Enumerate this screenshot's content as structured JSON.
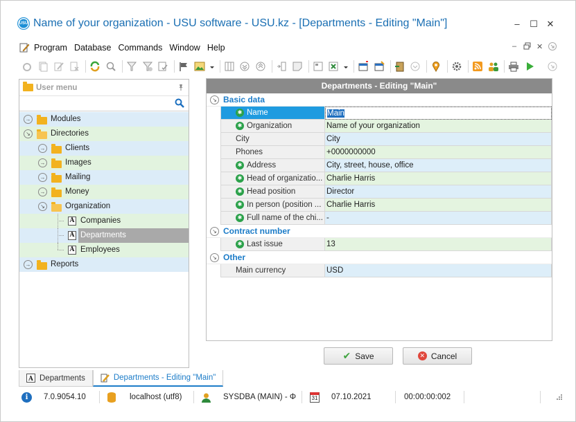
{
  "window": {
    "logo_text": "USU",
    "title": "Name of your organization - USU software - USU.kz - [Departments - Editing \"Main\"]",
    "controls": [
      "–",
      "☐",
      "✕"
    ]
  },
  "menubar": {
    "items": [
      "Program",
      "Database",
      "Commands",
      "Window",
      "Help"
    ],
    "mdi_controls": [
      "–",
      "🗗",
      "✕"
    ]
  },
  "left_panel": {
    "title": "User menu",
    "search_placeholder": "",
    "tree": [
      {
        "label": "Modules",
        "level": 0,
        "expander": "collapsed",
        "icon": "folder-icon",
        "bg": "blue"
      },
      {
        "label": "Directories",
        "level": 0,
        "expander": "expanded",
        "icon": "folder-open-icon",
        "bg": "green"
      },
      {
        "label": "Clients",
        "level": 1,
        "expander": "collapsed",
        "icon": "folder-icon",
        "bg": "blue"
      },
      {
        "label": "Images",
        "level": 1,
        "expander": "collapsed",
        "icon": "folder-icon",
        "bg": "green"
      },
      {
        "label": "Mailing",
        "level": 1,
        "expander": "collapsed",
        "icon": "folder-icon",
        "bg": "blue"
      },
      {
        "label": "Money",
        "level": 1,
        "expander": "collapsed",
        "icon": "folder-icon",
        "bg": "green"
      },
      {
        "label": "Organization",
        "level": 1,
        "expander": "expanded",
        "icon": "folder-open-icon",
        "bg": "blue"
      },
      {
        "label": "Companies",
        "level": 2,
        "expander": "none",
        "icon": "document-a-icon",
        "bg": "green"
      },
      {
        "label": "Departments",
        "level": 2,
        "expander": "none",
        "icon": "document-a-icon",
        "bg": "blue",
        "selected": true
      },
      {
        "label": "Employees",
        "level": 2,
        "expander": "none",
        "icon": "document-a-icon",
        "bg": "green"
      },
      {
        "label": "Reports",
        "level": 0,
        "expander": "collapsed",
        "icon": "folder-icon",
        "bg": "blue"
      }
    ]
  },
  "editor": {
    "header": "Departments - Editing \"Main\"",
    "categories": [
      {
        "label": "Basic data",
        "rows": [
          {
            "name": "Name",
            "value": "Main",
            "required": true,
            "active": true,
            "bg": "blue"
          },
          {
            "name": "Organization",
            "value": "Name of your organization",
            "required": true,
            "bg": "green"
          },
          {
            "name": "City",
            "value": "City",
            "required": false,
            "bg": "blue"
          },
          {
            "name": "Phones",
            "value": "+0000000000",
            "required": false,
            "bg": "green"
          },
          {
            "name": "Address",
            "value": "City, street, house, office",
            "required": true,
            "bg": "blue"
          },
          {
            "name": "Head of organizatio...",
            "value": "Charlie Harris",
            "required": true,
            "bg": "green"
          },
          {
            "name": "Head position",
            "value": "Director",
            "required": true,
            "bg": "blue"
          },
          {
            "name": "In person (position ...",
            "value": "Charlie Harris",
            "required": true,
            "bg": "green"
          },
          {
            "name": "Full name of the chi...",
            "value": "-",
            "required": true,
            "bg": "blue"
          }
        ]
      },
      {
        "label": "Contract number",
        "rows": [
          {
            "name": "Last issue",
            "value": "13",
            "required": true,
            "bg": "green"
          }
        ]
      },
      {
        "label": "Other",
        "rows": [
          {
            "name": "Main currency",
            "value": "USD",
            "required": false,
            "bg": "blue"
          }
        ]
      }
    ]
  },
  "buttons": {
    "save": "Save",
    "cancel": "Cancel"
  },
  "tabs": [
    {
      "label": "Departments",
      "active": false
    },
    {
      "label": "Departments - Editing \"Main\"",
      "active": true
    }
  ],
  "statusbar": {
    "version": "7.0.9054.10",
    "connection": "localhost (utf8)",
    "user": "SYSDBA (MAIN) - Φ",
    "date": "07.10.2021",
    "timer": "00:00:00:002"
  },
  "colors": {
    "accent": "#1c7cc8",
    "title": "#1a6fb3",
    "row_blue": "#dcecf8",
    "row_green": "#e2f3df",
    "required": "#2ba14a",
    "header_gray": "#8a8a8a"
  }
}
